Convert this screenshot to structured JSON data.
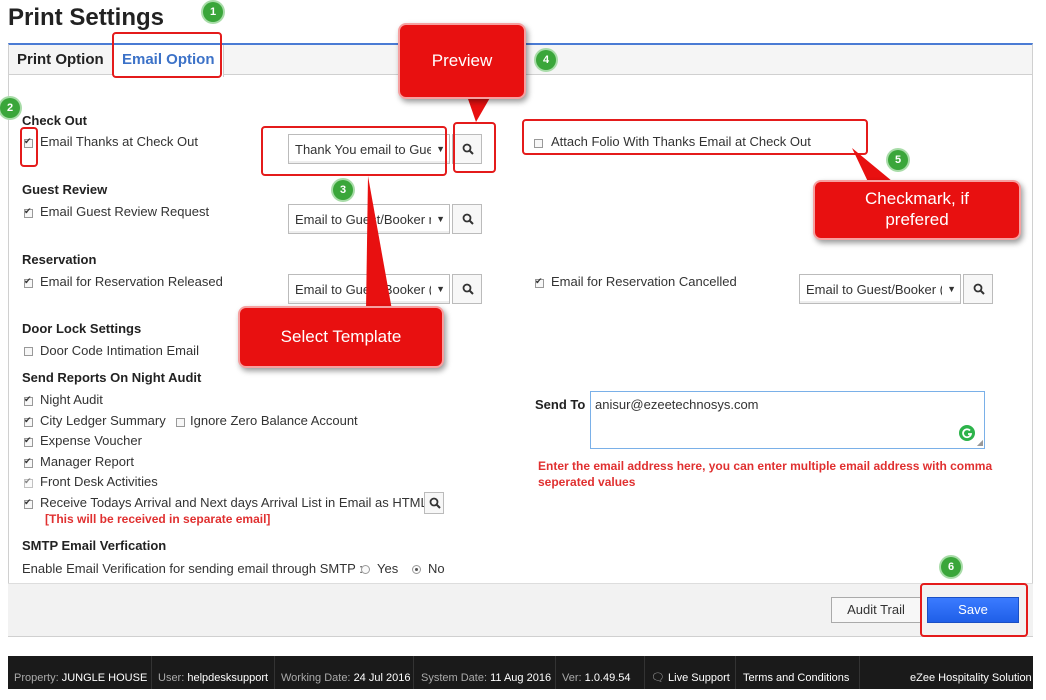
{
  "page": {
    "title": "Print Settings"
  },
  "tabs": [
    {
      "label": "Print Option"
    },
    {
      "label": "Email Option"
    }
  ],
  "checkout": {
    "title": "Check Out",
    "thanks_label": "Email Thanks at Check Out",
    "thanks_checked": true,
    "thanks_template": "Thank You email to Gue",
    "attach_label": "Attach Folio With Thanks Email at Check Out",
    "attach_checked": false
  },
  "guest_review": {
    "title": "Guest Review",
    "label": "Email Guest Review Request",
    "checked": true,
    "template": "Email to Guest/Booker r"
  },
  "reservation": {
    "title": "Reservation",
    "released_label": "Email for Reservation Released",
    "released_template": "Email to Guest/Booker (",
    "cancelled_label": "Email for Reservation Cancelled",
    "cancelled_template": "Email to Guest/Booker ("
  },
  "door_lock": {
    "title": "Door Lock Settings",
    "label": "Door Code Intimation Email"
  },
  "night_audit": {
    "title": "Send Reports On Night Audit",
    "items": [
      "Night Audit",
      "City Ledger Summary",
      "Expense Voucher",
      "Manager Report",
      "Front Desk Activities",
      "Receive Todays Arrival and Next days Arrival List in Email as HTML"
    ],
    "ignore_zero_label": "Ignore Zero Balance Account",
    "separate_note": "[This will be received in separate email]"
  },
  "send_to": {
    "label": "Send To",
    "value": "anisur@ezeetechnosys.com",
    "note_line1": "Enter the email address here, you can enter multiple email address with comma",
    "note_line2": "seperated values"
  },
  "smtp": {
    "title": "SMTP Email Verfication",
    "label": "Enable Email Verification for sending email through SMTP :",
    "yes": "Yes",
    "no": "No",
    "selected": "No"
  },
  "buttons": {
    "audit_trail": "Audit Trail",
    "save": "Save"
  },
  "status_bar": {
    "property_label": "Property:",
    "property": "JUNGLE HOUSE",
    "user_label": "User:",
    "user": "helpdesksupport",
    "working_date_label": "Working Date:",
    "working_date": "24 Jul 2016",
    "system_date_label": "System Date:",
    "system_date": "11 Aug 2016",
    "version_label": "Ver:",
    "version": "1.0.49.54",
    "live_support": "Live Support",
    "terms": "Terms and Conditions",
    "brand": "eZee Hospitality Solution"
  },
  "annotations": {
    "badges": [
      "1",
      "2",
      "3",
      "4",
      "5",
      "6"
    ],
    "preview": "Preview",
    "select_template": "Select Template",
    "checkmark_line1": "Checkmark, if",
    "checkmark_line2": "prefered"
  },
  "colors": {
    "accent": "#3c72c8",
    "save": "#1f5fe8",
    "note_red": "#e03030",
    "annotation_red": "#e81010",
    "badge_green": "#3aa63a"
  }
}
